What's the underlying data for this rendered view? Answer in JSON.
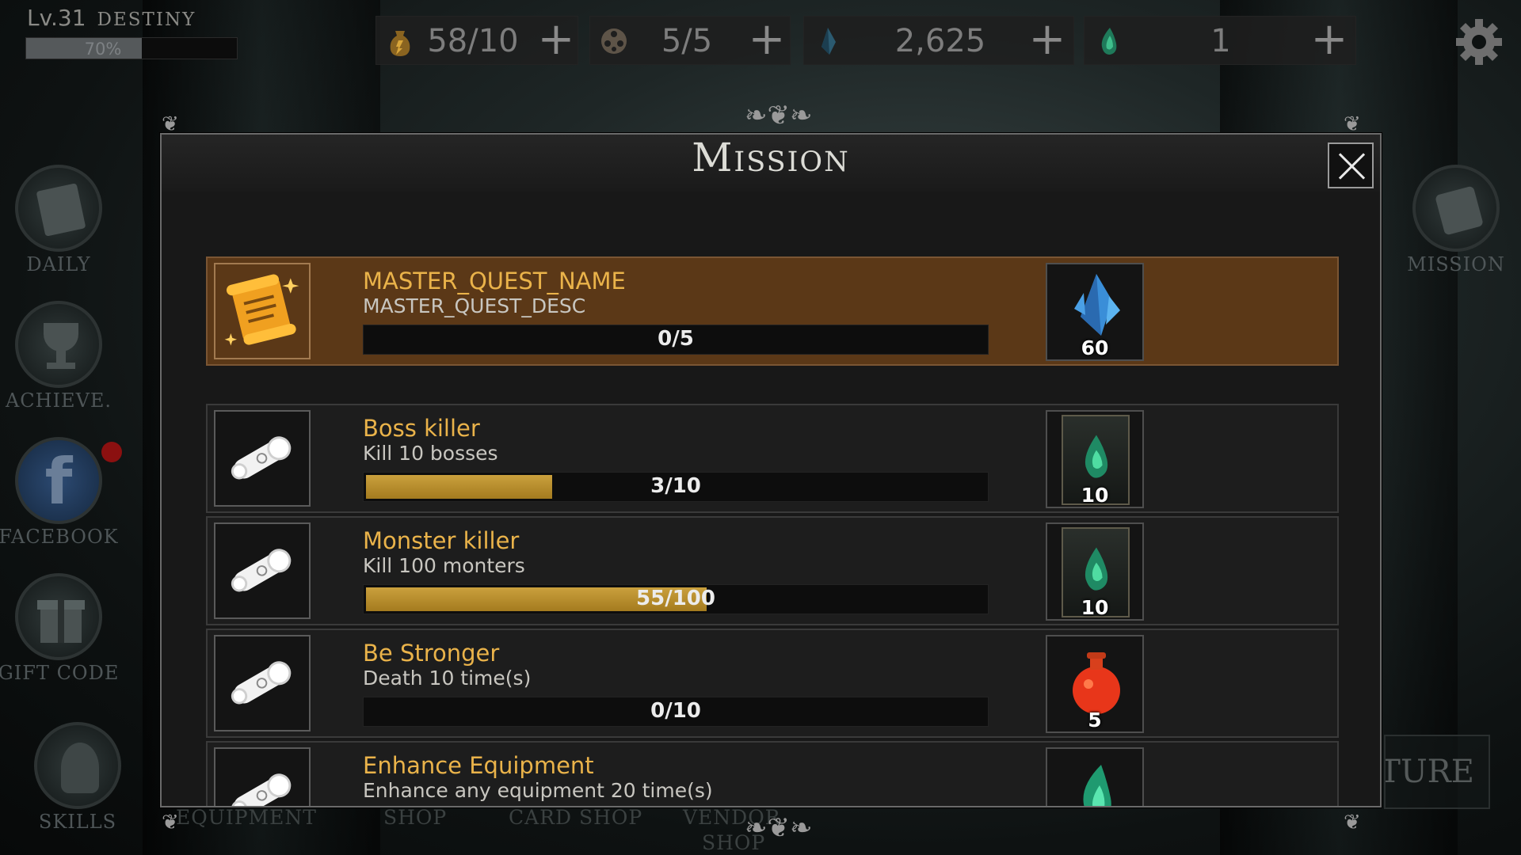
{
  "player": {
    "level": "Lv.31",
    "name": "DESTINY",
    "xp_label": "70%",
    "xp_progress": 0.55
  },
  "resources": [
    {
      "icon": "potion-bag-icon",
      "value": "58/10"
    },
    {
      "icon": "film-reel-icon",
      "value": "5/5"
    },
    {
      "icon": "blue-crystal-icon",
      "value": "2,625"
    },
    {
      "icon": "green-soul-flame-icon",
      "value": "1"
    }
  ],
  "left_menu": [
    {
      "icon": "daily-book-icon",
      "label": "DAILY"
    },
    {
      "icon": "trophy-icon",
      "label": "ACHIEVE."
    },
    {
      "icon": "facebook-icon",
      "label": "FACEBOOK"
    },
    {
      "icon": "gift-icon",
      "label": "GIFT CODE"
    },
    {
      "icon": "skills-icon",
      "label": "SKILLS"
    }
  ],
  "right_menu": [
    {
      "icon": "mission-scroll-icon",
      "label": "MISSION"
    }
  ],
  "bottom_nav": {
    "equipment": "EQUIPMENT",
    "shop": "SHOP",
    "card_shop": "CARD SHOP",
    "vendor_shop_1": "VENDOR",
    "vendor_shop_2": "SHOP"
  },
  "adventure_label": "TURE",
  "modal": {
    "title": "Mission",
    "missions": [
      {
        "name": "MASTER_QUEST_NAME",
        "desc": "MASTER_QUEST_DESC",
        "progress": "0/5",
        "progress_ratio": 0,
        "reward_icon": "blue-crystal-icon",
        "reward_count": "60",
        "master": true
      },
      {
        "name": "Boss killer",
        "desc": "Kill 10 bosses",
        "progress": "3/10",
        "progress_ratio": 0.3,
        "reward_icon": "soul-card-icon",
        "reward_count": "10"
      },
      {
        "name": "Monster killer",
        "desc": "Kill 100 monters",
        "progress": "55/100",
        "progress_ratio": 0.55,
        "reward_icon": "soul-card-icon",
        "reward_count": "10"
      },
      {
        "name": "Be Stronger",
        "desc": "Death 10 time(s)",
        "progress": "0/10",
        "progress_ratio": 0,
        "reward_icon": "red-potion-icon",
        "reward_count": "5"
      },
      {
        "name": "Enhance Equipment",
        "desc": "Enhance any equipment 20 time(s)",
        "progress": "",
        "progress_ratio": 0,
        "reward_icon": "green-soul-flame-icon",
        "reward_count": ""
      }
    ]
  },
  "colors": {
    "quest_name": "#eab34a",
    "master_row": "#5b3817",
    "progress_fill": "#b88c2a"
  }
}
